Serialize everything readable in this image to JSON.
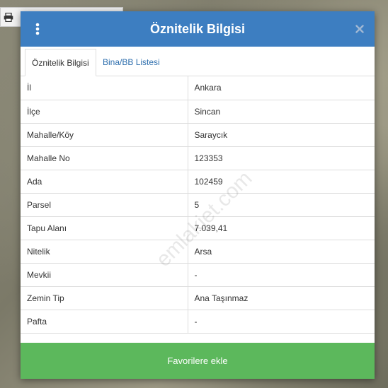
{
  "modal": {
    "title": "Öznitelik Bilgisi",
    "tabs": [
      {
        "label": "Öznitelik Bilgisi",
        "active": true
      },
      {
        "label": "Bina/BB Listesi",
        "active": false
      }
    ],
    "rows": [
      {
        "key": "İl",
        "value": "Ankara"
      },
      {
        "key": "İlçe",
        "value": "Sincan"
      },
      {
        "key": "Mahalle/Köy",
        "value": "Saraycık"
      },
      {
        "key": "Mahalle No",
        "value": "123353"
      },
      {
        "key": "Ada",
        "value": "102459"
      },
      {
        "key": "Parsel",
        "value": "5"
      },
      {
        "key": "Tapu Alanı",
        "value": "7.039,41"
      },
      {
        "key": "Nitelik",
        "value": "Arsa"
      },
      {
        "key": "Mevkii",
        "value": "-"
      },
      {
        "key": "Zemin Tip",
        "value": "Ana Taşınmaz"
      },
      {
        "key": "Pafta",
        "value": "-"
      }
    ],
    "favorite_button": "Favorilere ekle"
  },
  "watermark": "emlakjet.com",
  "icons": {
    "menu": "vertical-ellipsis-icon",
    "close": "close-icon",
    "print": "printer-icon"
  },
  "colors": {
    "header": "#3d7ec1",
    "button": "#5cb85c",
    "tab_link": "#2f6fae"
  }
}
